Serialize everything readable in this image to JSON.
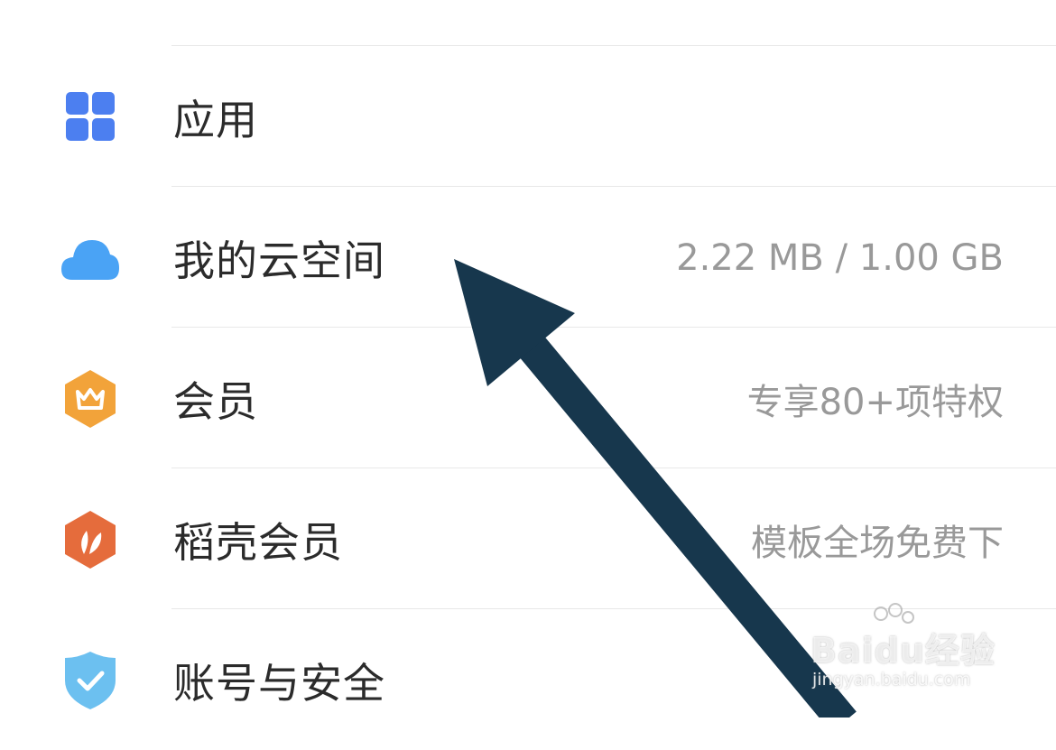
{
  "menu": {
    "items": [
      {
        "label": "应用",
        "value": "",
        "icon": "grid-icon",
        "icon_color": "#4c7ff0"
      },
      {
        "label": "我的云空间",
        "value": "2.22 MB / 1.00 GB",
        "icon": "cloud-icon",
        "icon_color": "#4aa3f5"
      },
      {
        "label": "会员",
        "value": "专享80+项特权",
        "icon": "crown-icon",
        "icon_color": "#f2a33a"
      },
      {
        "label": "稻壳会员",
        "value": "模板全场免费下",
        "icon": "leaf-icon",
        "icon_color": "#e56c3c"
      },
      {
        "label": "账号与安全",
        "value": "",
        "icon": "shield-check-icon",
        "icon_color": "#6cc0f0"
      }
    ]
  },
  "annotation": {
    "arrow_color": "#17374d"
  },
  "watermark": {
    "brand": "Baidu经验",
    "url": "jingyan.baidu.com"
  }
}
